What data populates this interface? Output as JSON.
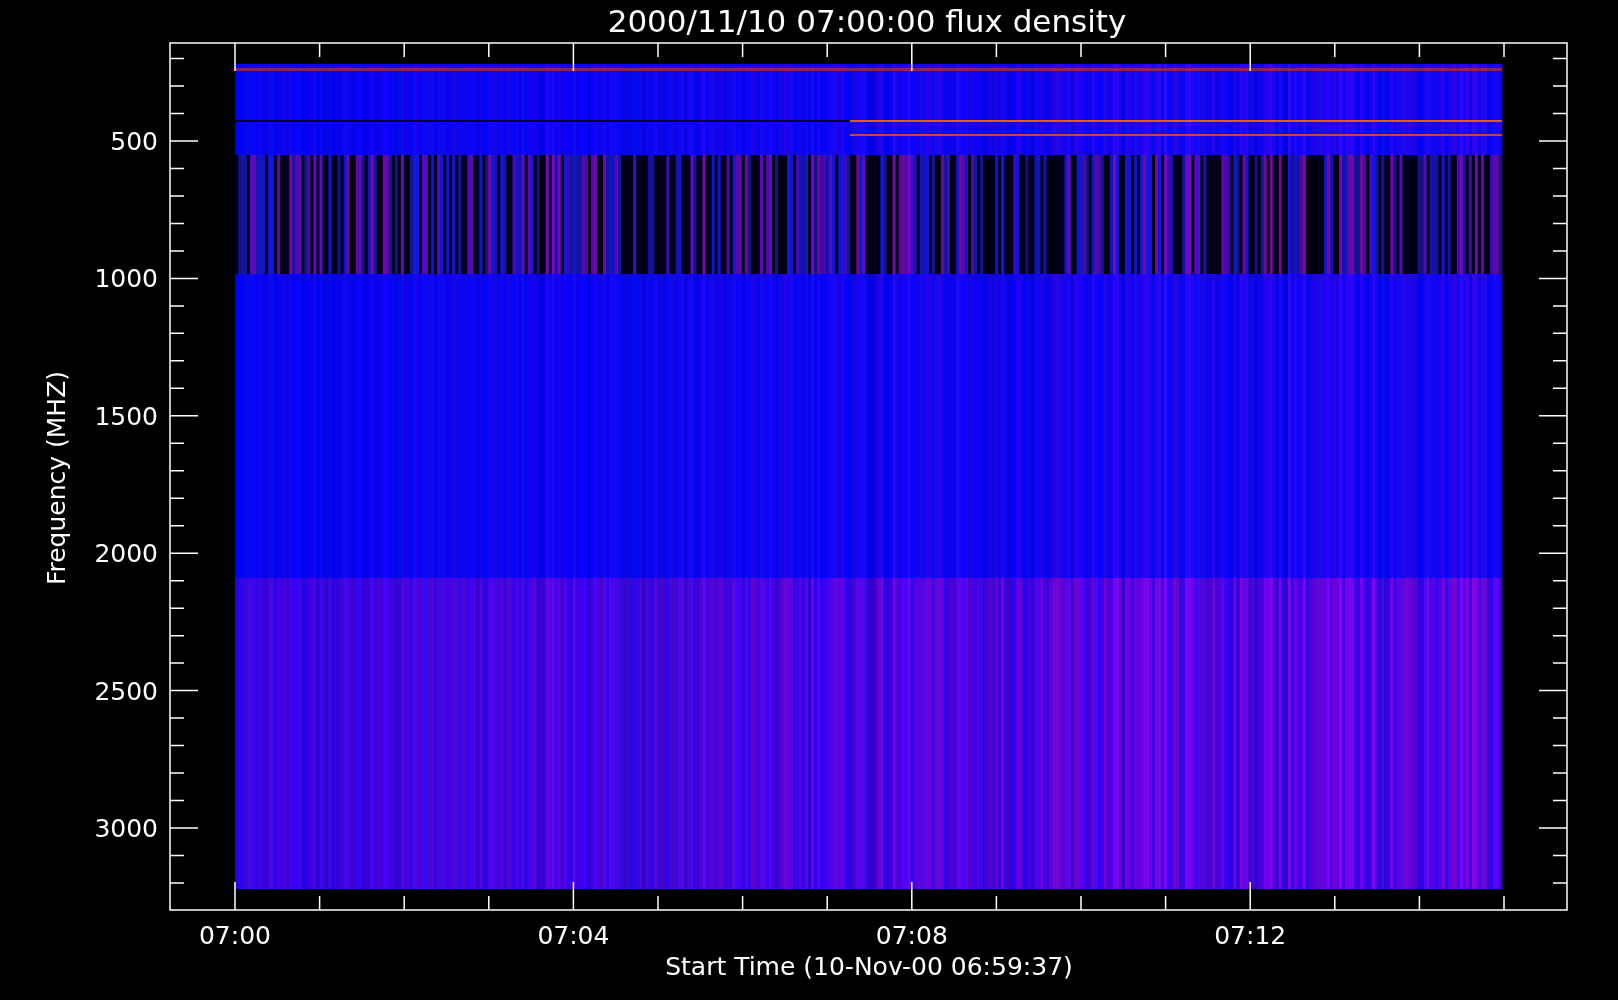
{
  "title": "2000/11/10 07:00:00 flux density",
  "y_axis": {
    "label": "Frequency (MHZ)",
    "ticks": [
      "500",
      "1000",
      "1500",
      "2000",
      "2500",
      "3000"
    ]
  },
  "x_axis": {
    "label": "Start Time (10-Nov-00 06:59:37)",
    "ticks": [
      "07:00",
      "07:04",
      "07:08",
      "07:12"
    ]
  }
}
